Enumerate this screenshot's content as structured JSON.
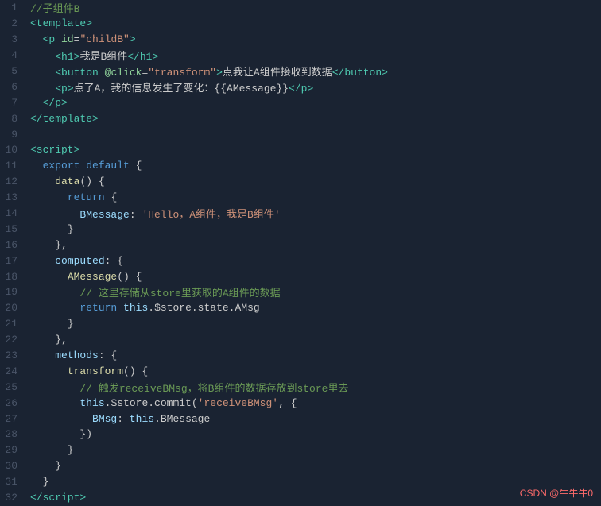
{
  "editor": {
    "background": "#1a2332",
    "lines": [
      {
        "num": 1,
        "html": "<span class='c-comment'>//子组件B</span>"
      },
      {
        "num": 2,
        "html": "<span class='c-tag'>&lt;template&gt;</span>"
      },
      {
        "num": 3,
        "html": "  <span class='c-tag'>&lt;p </span><span class='c-attr'>id</span><span class='c-default'>=</span><span class='c-attr-val'>\"childB\"</span><span class='c-tag'>&gt;</span>"
      },
      {
        "num": 4,
        "html": "    <span class='c-tag'>&lt;h1&gt;</span><span class='c-default'>我是B组件</span><span class='c-tag'>&lt;/h1&gt;</span>"
      },
      {
        "num": 5,
        "html": "    <span class='c-tag'>&lt;button </span><span class='c-attr'>@click</span><span class='c-default'>=</span><span class='c-attr-val'>\"transform\"</span><span class='c-tag'>&gt;</span><span class='c-default'>点我让A组件接收到数据</span><span class='c-tag'>&lt;/button&gt;</span>"
      },
      {
        "num": 6,
        "html": "    <span class='c-tag'>&lt;p&gt;</span><span class='c-default'>点了A，我的信息发生了变化：{{AMessage}}</span><span class='c-tag'>&lt;/p&gt;</span>"
      },
      {
        "num": 7,
        "html": "  <span class='c-tag'>&lt;/p&gt;</span>"
      },
      {
        "num": 8,
        "html": "<span class='c-tag'>&lt;/template&gt;</span>"
      },
      {
        "num": 9,
        "html": ""
      },
      {
        "num": 10,
        "html": "<span class='c-tag'>&lt;script&gt;</span>"
      },
      {
        "num": 11,
        "html": "  <span class='c-keyword'>export default</span> <span class='c-default'>{</span>"
      },
      {
        "num": 12,
        "html": "    <span class='c-method'>data</span><span class='c-default'>() {</span>"
      },
      {
        "num": 13,
        "html": "      <span class='c-keyword'>return</span> <span class='c-default'>{</span>"
      },
      {
        "num": 14,
        "html": "        <span class='c-prop'>BMessage</span><span class='c-default'>: </span><span class='c-string'>'Hello，A组件，我是B组件'</span>"
      },
      {
        "num": 15,
        "html": "      <span class='c-default'>}</span>"
      },
      {
        "num": 16,
        "html": "    <span class='c-default'>},</span>"
      },
      {
        "num": 17,
        "html": "    <span class='c-prop'>computed</span><span class='c-default'>: {</span>"
      },
      {
        "num": 18,
        "html": "      <span class='c-method'>AMessage</span><span class='c-default'>() {</span>"
      },
      {
        "num": 19,
        "html": "        <span class='c-comment'>// 这里存储从store里获取的A组件的数据</span>"
      },
      {
        "num": 20,
        "html": "        <span class='c-keyword'>return</span> <span class='c-this'>this</span><span class='c-default'>.$store.state.AMsg</span>"
      },
      {
        "num": 21,
        "html": "      <span class='c-default'>}</span>"
      },
      {
        "num": 22,
        "html": "    <span class='c-default'>},</span>"
      },
      {
        "num": 23,
        "html": "    <span class='c-prop'>methods</span><span class='c-default'>: {</span>"
      },
      {
        "num": 24,
        "html": "      <span class='c-method'>transform</span><span class='c-default'>() {</span>"
      },
      {
        "num": 25,
        "html": "        <span class='c-comment'>// 触发receiveBMsg，将B组件的数据存放到store里去</span>"
      },
      {
        "num": 26,
        "html": "        <span class='c-this'>this</span><span class='c-default'>.$store.commit(</span><span class='c-string'>'receiveBMsg'</span><span class='c-default'>, {</span>"
      },
      {
        "num": 27,
        "html": "          <span class='c-prop'>BMsg</span><span class='c-default'>: </span><span class='c-this'>this</span><span class='c-default'>.BMessage</span>"
      },
      {
        "num": 28,
        "html": "        <span class='c-default'>})"
      },
      {
        "num": 29,
        "html": "      <span class='c-default'>}"
      },
      {
        "num": 30,
        "html": "    <span class='c-default'>}"
      },
      {
        "num": 31,
        "html": "  <span class='c-default'>}"
      },
      {
        "num": 32,
        "html": "<span class='c-tag'>&lt;/script&gt;</span>"
      }
    ]
  },
  "watermark": {
    "prefix": "CSDN",
    "suffix": "@牛牛牛0"
  }
}
